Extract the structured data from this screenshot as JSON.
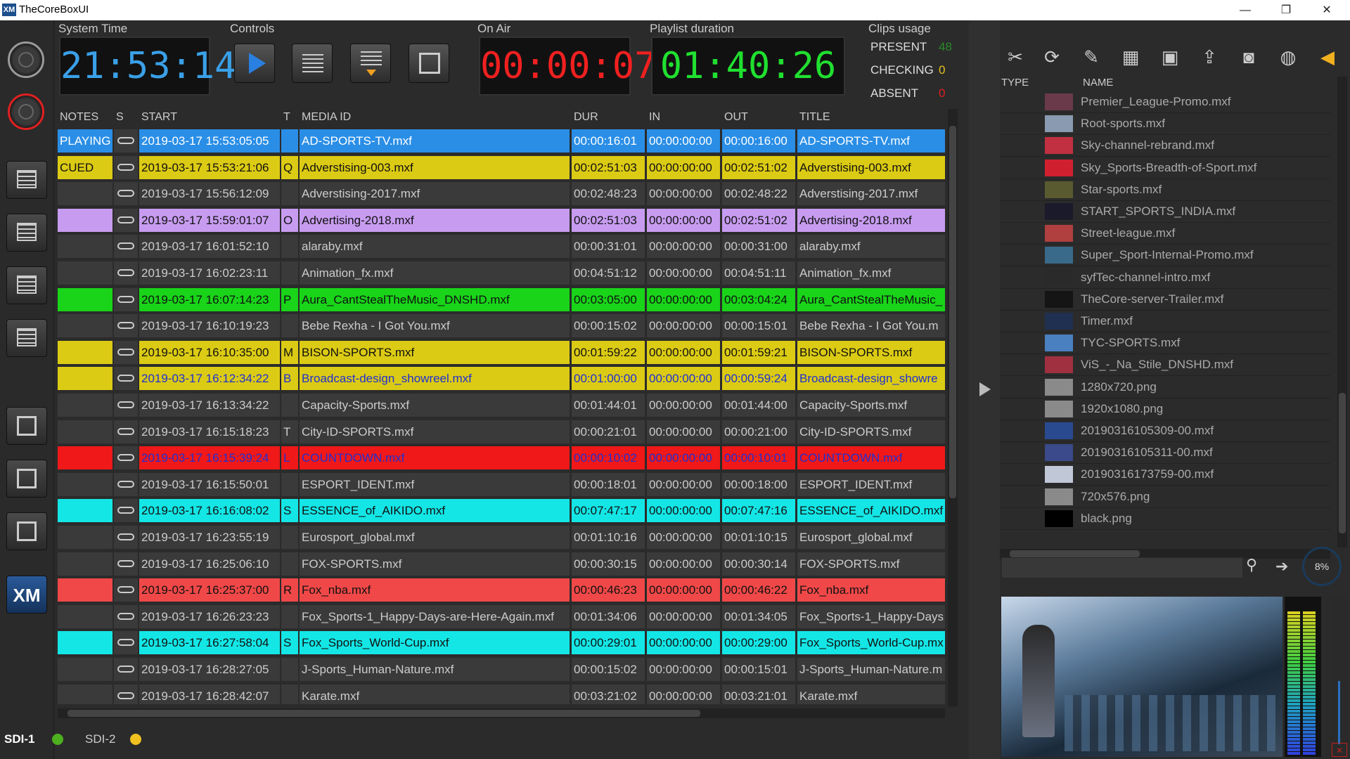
{
  "window": {
    "title": "TheCoreBoxUI",
    "app_icon": "XM",
    "minimize": "—",
    "maximize": "❐",
    "close": "✕"
  },
  "header": {
    "system_time_label": "System Time",
    "system_time": "21:53:14",
    "controls_label": "Controls",
    "on_air_label": "On Air",
    "on_air": "00:00:07",
    "playlist_duration_label": "Playlist duration",
    "playlist_duration": "01:40:26",
    "clips_usage_label": "Clips usage",
    "present_label": "PRESENT",
    "present_count": "48",
    "checking_label": "CHECKING",
    "checking_count": "0",
    "absent_label": "ABSENT",
    "absent_count": "0"
  },
  "colors": {
    "playing": "#2a8ee6",
    "cued": "#dccb14",
    "purple": "#c79cf0",
    "green": "#19d419",
    "red": "#f01818",
    "cyan": "#14e6e6",
    "salmon": "#f04848",
    "default_row": "#3a3a3a"
  },
  "table": {
    "columns": [
      "NOTES",
      "S",
      "START",
      "T",
      "MEDIA ID",
      "DUR",
      "IN",
      "OUT",
      "TITLE"
    ],
    "rows": [
      {
        "notes": "PLAYING",
        "start": "2019-03-17 15:53:05:05",
        "t": "",
        "media": "AD-SPORTS-TV.mxf",
        "dur": "00:00:16:01",
        "in": "00:00:00:00",
        "out": "00:00:16:00",
        "title": "AD-SPORTS-TV.mxf",
        "color": "#2a8ee6",
        "text": "#ffffff",
        "notes_color": "#2a8ee6"
      },
      {
        "notes": "CUED",
        "start": "2019-03-17 15:53:21:06",
        "t": "Q",
        "media": "Adverstising-003.mxf",
        "dur": "00:02:51:03",
        "in": "00:00:00:00",
        "out": "00:02:51:02",
        "title": "Adverstising-003.mxf",
        "color": "#dccb14",
        "text": "#111111",
        "notes_color": "#dccb14"
      },
      {
        "notes": "",
        "start": "2019-03-17 15:56:12:09",
        "t": "",
        "media": "Adverstising-2017.mxf",
        "dur": "00:02:48:23",
        "in": "00:00:00:00",
        "out": "00:02:48:22",
        "title": "Adverstising-2017.mxf",
        "color": "",
        "text": "#cccccc",
        "notes_color": ""
      },
      {
        "notes": "",
        "start": "2019-03-17 15:59:01:07",
        "t": "O",
        "media": "Advertising-2018.mxf",
        "dur": "00:02:51:03",
        "in": "00:00:00:00",
        "out": "00:02:51:02",
        "title": "Advertising-2018.mxf",
        "color": "#c79cf0",
        "text": "#111111",
        "notes_color": "#c79cf0"
      },
      {
        "notes": "",
        "start": "2019-03-17 16:01:52:10",
        "t": "",
        "media": "alaraby.mxf",
        "dur": "00:00:31:01",
        "in": "00:00:00:00",
        "out": "00:00:31:00",
        "title": "alaraby.mxf",
        "color": "",
        "text": "#cccccc",
        "notes_color": ""
      },
      {
        "notes": "",
        "start": "2019-03-17 16:02:23:11",
        "t": "",
        "media": "Animation_fx.mxf",
        "dur": "00:04:51:12",
        "in": "00:00:00:00",
        "out": "00:04:51:11",
        "title": "Animation_fx.mxf",
        "color": "",
        "text": "#cccccc",
        "notes_color": ""
      },
      {
        "notes": "",
        "start": "2019-03-17 16:07:14:23",
        "t": "P",
        "media": "Aura_CantStealTheMusic_DNSHD.mxf",
        "dur": "00:03:05:00",
        "in": "00:00:00:00",
        "out": "00:03:04:24",
        "title": "Aura_CantStealTheMusic_",
        "color": "#19d419",
        "text": "#111111",
        "notes_color": "#19d419"
      },
      {
        "notes": "",
        "start": "2019-03-17 16:10:19:23",
        "t": "",
        "media": "Bebe Rexha - I Got You.mxf",
        "dur": "00:00:15:02",
        "in": "00:00:00:00",
        "out": "00:00:15:01",
        "title": "Bebe Rexha - I Got You.m",
        "color": "",
        "text": "#cccccc",
        "notes_color": ""
      },
      {
        "notes": "",
        "start": "2019-03-17 16:10:35:00",
        "t": "M",
        "media": "BISON-SPORTS.mxf",
        "dur": "00:01:59:22",
        "in": "00:00:00:00",
        "out": "00:01:59:21",
        "title": "BISON-SPORTS.mxf",
        "color": "#dccb14",
        "text": "#111111",
        "notes_color": "#dccb14"
      },
      {
        "notes": "",
        "start": "2019-03-17 16:12:34:22",
        "t": "B",
        "media": "Broadcast-design_showreel.mxf",
        "dur": "00:01:00:00",
        "in": "00:00:00:00",
        "out": "00:00:59:24",
        "title": "Broadcast-design_showre",
        "color": "#dccb14",
        "text": "#2030d0",
        "notes_color": "#dccb14"
      },
      {
        "notes": "",
        "start": "2019-03-17 16:13:34:22",
        "t": "",
        "media": "Capacity-Sports.mxf",
        "dur": "00:01:44:01",
        "in": "00:00:00:00",
        "out": "00:01:44:00",
        "title": "Capacity-Sports.mxf",
        "color": "",
        "text": "#cccccc",
        "notes_color": ""
      },
      {
        "notes": "",
        "start": "2019-03-17 16:15:18:23",
        "t": "T",
        "media": "City-ID-SPORTS.mxf",
        "dur": "00:00:21:01",
        "in": "00:00:00:00",
        "out": "00:00:21:00",
        "title": "City-ID-SPORTS.mxf",
        "color": "",
        "text": "#cccccc",
        "notes_color": ""
      },
      {
        "notes": "",
        "start": "2019-03-17 16:15:39:24",
        "t": "L",
        "media": "COUNTDOWN.mxf",
        "dur": "00:00:10:02",
        "in": "00:00:00:00",
        "out": "00:00:10:01",
        "title": "COUNTDOWN.mxf",
        "color": "#f01818",
        "text": "#2030d0",
        "notes_color": "#f01818"
      },
      {
        "notes": "",
        "start": "2019-03-17 16:15:50:01",
        "t": "",
        "media": "ESPORT_IDENT.mxf",
        "dur": "00:00:18:01",
        "in": "00:00:00:00",
        "out": "00:00:18:00",
        "title": "ESPORT_IDENT.mxf",
        "color": "",
        "text": "#cccccc",
        "notes_color": ""
      },
      {
        "notes": "",
        "start": "2019-03-17 16:16:08:02",
        "t": "S",
        "media": "ESSENCE_of_AIKIDO.mxf",
        "dur": "00:07:47:17",
        "in": "00:00:00:00",
        "out": "00:07:47:16",
        "title": "ESSENCE_of_AIKIDO.mxf",
        "color": "#14e6e6",
        "text": "#111111",
        "notes_color": "#14e6e6"
      },
      {
        "notes": "",
        "start": "2019-03-17 16:23:55:19",
        "t": "",
        "media": "Eurosport_global.mxf",
        "dur": "00:01:10:16",
        "in": "00:00:00:00",
        "out": "00:01:10:15",
        "title": "Eurosport_global.mxf",
        "color": "",
        "text": "#cccccc",
        "notes_color": ""
      },
      {
        "notes": "",
        "start": "2019-03-17 16:25:06:10",
        "t": "",
        "media": "FOX-SPORTS.mxf",
        "dur": "00:00:30:15",
        "in": "00:00:00:00",
        "out": "00:00:30:14",
        "title": "FOX-SPORTS.mxf",
        "color": "",
        "text": "#cccccc",
        "notes_color": ""
      },
      {
        "notes": "",
        "start": "2019-03-17 16:25:37:00",
        "t": "R",
        "media": "Fox_nba.mxf",
        "dur": "00:00:46:23",
        "in": "00:00:00:00",
        "out": "00:00:46:22",
        "title": "Fox_nba.mxf",
        "color": "#f04848",
        "text": "#111111",
        "notes_color": "#f04848"
      },
      {
        "notes": "",
        "start": "2019-03-17 16:26:23:23",
        "t": "",
        "media": "Fox_Sports-1_Happy-Days-are-Here-Again.mxf",
        "dur": "00:01:34:06",
        "in": "00:00:00:00",
        "out": "00:01:34:05",
        "title": "Fox_Sports-1_Happy-Days",
        "color": "",
        "text": "#cccccc",
        "notes_color": ""
      },
      {
        "notes": "",
        "start": "2019-03-17 16:27:58:04",
        "t": "S",
        "media": "Fox_Sports_World-Cup.mxf",
        "dur": "00:00:29:01",
        "in": "00:00:00:00",
        "out": "00:00:29:00",
        "title": "Fox_Sports_World-Cup.mx",
        "color": "#14e6e6",
        "text": "#111111",
        "notes_color": "#14e6e6"
      },
      {
        "notes": "",
        "start": "2019-03-17 16:28:27:05",
        "t": "",
        "media": "J-Sports_Human-Nature.mxf",
        "dur": "00:00:15:02",
        "in": "00:00:00:00",
        "out": "00:00:15:01",
        "title": "J-Sports_Human-Nature.m",
        "color": "",
        "text": "#cccccc",
        "notes_color": ""
      },
      {
        "notes": "",
        "start": "2019-03-17 16:28:42:07",
        "t": "",
        "media": "Karate.mxf",
        "dur": "00:03:21:02",
        "in": "00:00:00:00",
        "out": "00:03:21:01",
        "title": "Karate.mxf",
        "color": "",
        "text": "#cccccc",
        "notes_color": ""
      }
    ]
  },
  "outputs": [
    {
      "label": "SDI-1",
      "status_color": "#4caf20"
    },
    {
      "label": "SDI-2",
      "status_color": "#f0c020"
    }
  ],
  "browser": {
    "columns": [
      "TYPE",
      "NAME"
    ],
    "files": [
      {
        "name": "Premier_League-Promo.mxf",
        "thumb": "#6a3a4a"
      },
      {
        "name": "Root-sports.mxf",
        "thumb": "#8a9ab0"
      },
      {
        "name": "Sky-channel-rebrand.mxf",
        "thumb": "#c03040"
      },
      {
        "name": "Sky_Sports-Breadth-of-Sport.mxf",
        "thumb": "#d02030"
      },
      {
        "name": "Star-sports.mxf",
        "thumb": "#5a5a30"
      },
      {
        "name": "START_SPORTS_INDIA.mxf",
        "thumb": "#1a1a2a"
      },
      {
        "name": "Street-league.mxf",
        "thumb": "#b04040"
      },
      {
        "name": "Super_Sport-Internal-Promo.mxf",
        "thumb": "#3a6a8a"
      },
      {
        "name": "syfTec-channel-intro.mxf",
        "thumb": "#2a2a2a"
      },
      {
        "name": "TheCore-server-Trailer.mxf",
        "thumb": "#151515"
      },
      {
        "name": "Timer.mxf",
        "thumb": "#203050"
      },
      {
        "name": "TYC-SPORTS.mxf",
        "thumb": "#4a80c0"
      },
      {
        "name": "ViS_-_Na_Stile_DNSHD.mxf",
        "thumb": "#a03040"
      },
      {
        "name": "1280x720.png",
        "thumb": "#8a8a8a"
      },
      {
        "name": "1920x1080.png",
        "thumb": "#8a8a8a"
      },
      {
        "name": "20190316105309-00.mxf",
        "thumb": "#2a4a90"
      },
      {
        "name": "20190316105311-00.mxf",
        "thumb": "#3a4a8a"
      },
      {
        "name": "20190316173759-00.mxf",
        "thumb": "#c0c8d8"
      },
      {
        "name": "720x576.png",
        "thumb": "#8a8a8a"
      },
      {
        "name": "black.png",
        "thumb": "#000000"
      }
    ],
    "search_placeholder": "",
    "progress": "8%"
  }
}
